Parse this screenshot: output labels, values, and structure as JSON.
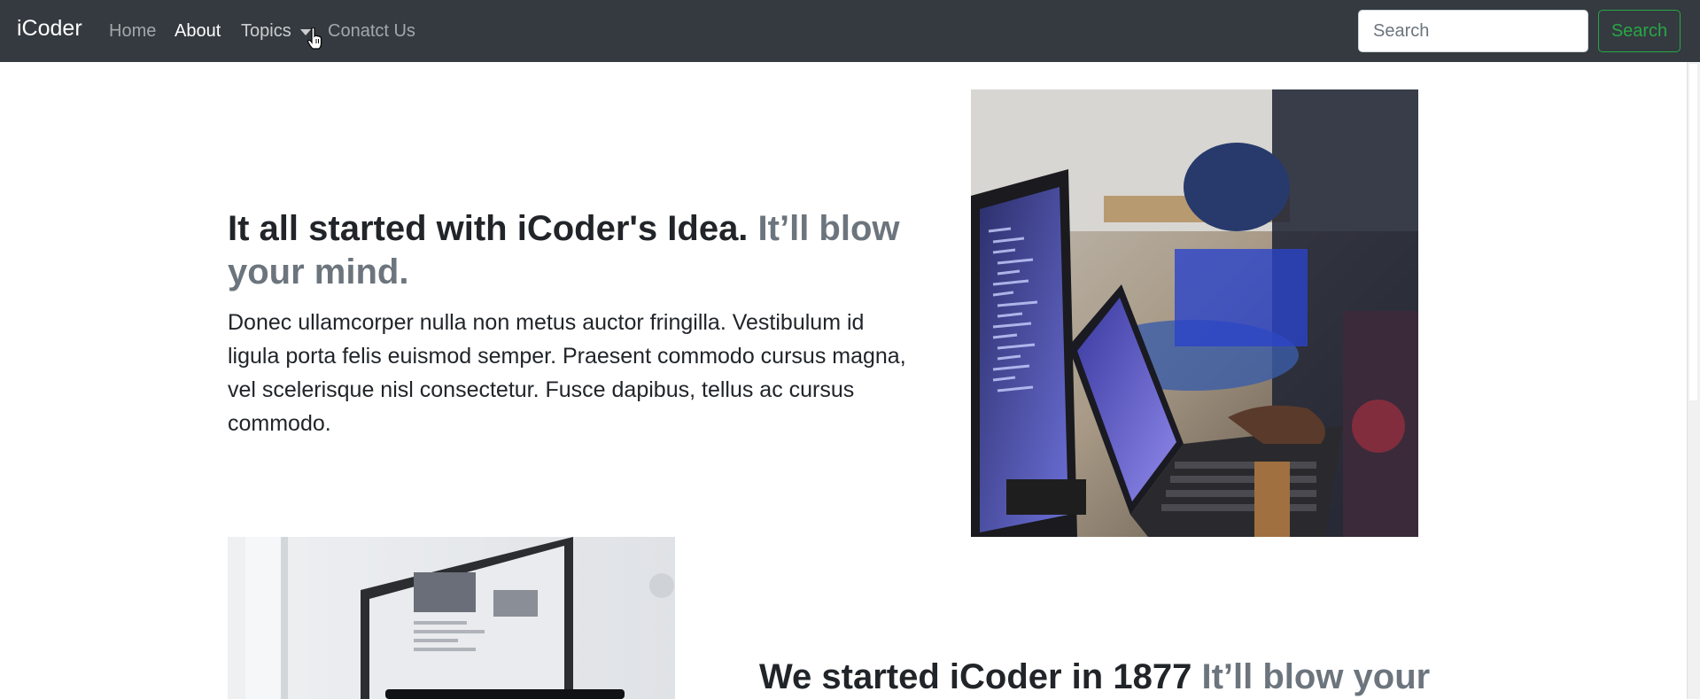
{
  "navbar": {
    "brand": "iCoder",
    "links": [
      {
        "label": "Home"
      },
      {
        "label": "About"
      },
      {
        "label": "Topics"
      },
      {
        "label": "Conatct Us"
      }
    ],
    "search": {
      "placeholder": "Search",
      "button_label": "Search"
    }
  },
  "features": [
    {
      "heading": "It all started with iCoder's Idea.",
      "heading_muted": "It’ll blow your mind.",
      "lead": "Donec ullamcorper nulla non metus auctor fringilla. Vestibulum id ligula porta felis euismod semper. Praesent commodo cursus magna, vel scelerisque nisl consectetur. Fusce dapibus, tellus ac cursus commodo."
    },
    {
      "heading": "We started iCoder in 1877",
      "heading_muted": "It’ll blow your"
    }
  ],
  "colors": {
    "navbar_bg": "#343a40",
    "muted_text": "#6c757d",
    "success": "#28a745"
  }
}
